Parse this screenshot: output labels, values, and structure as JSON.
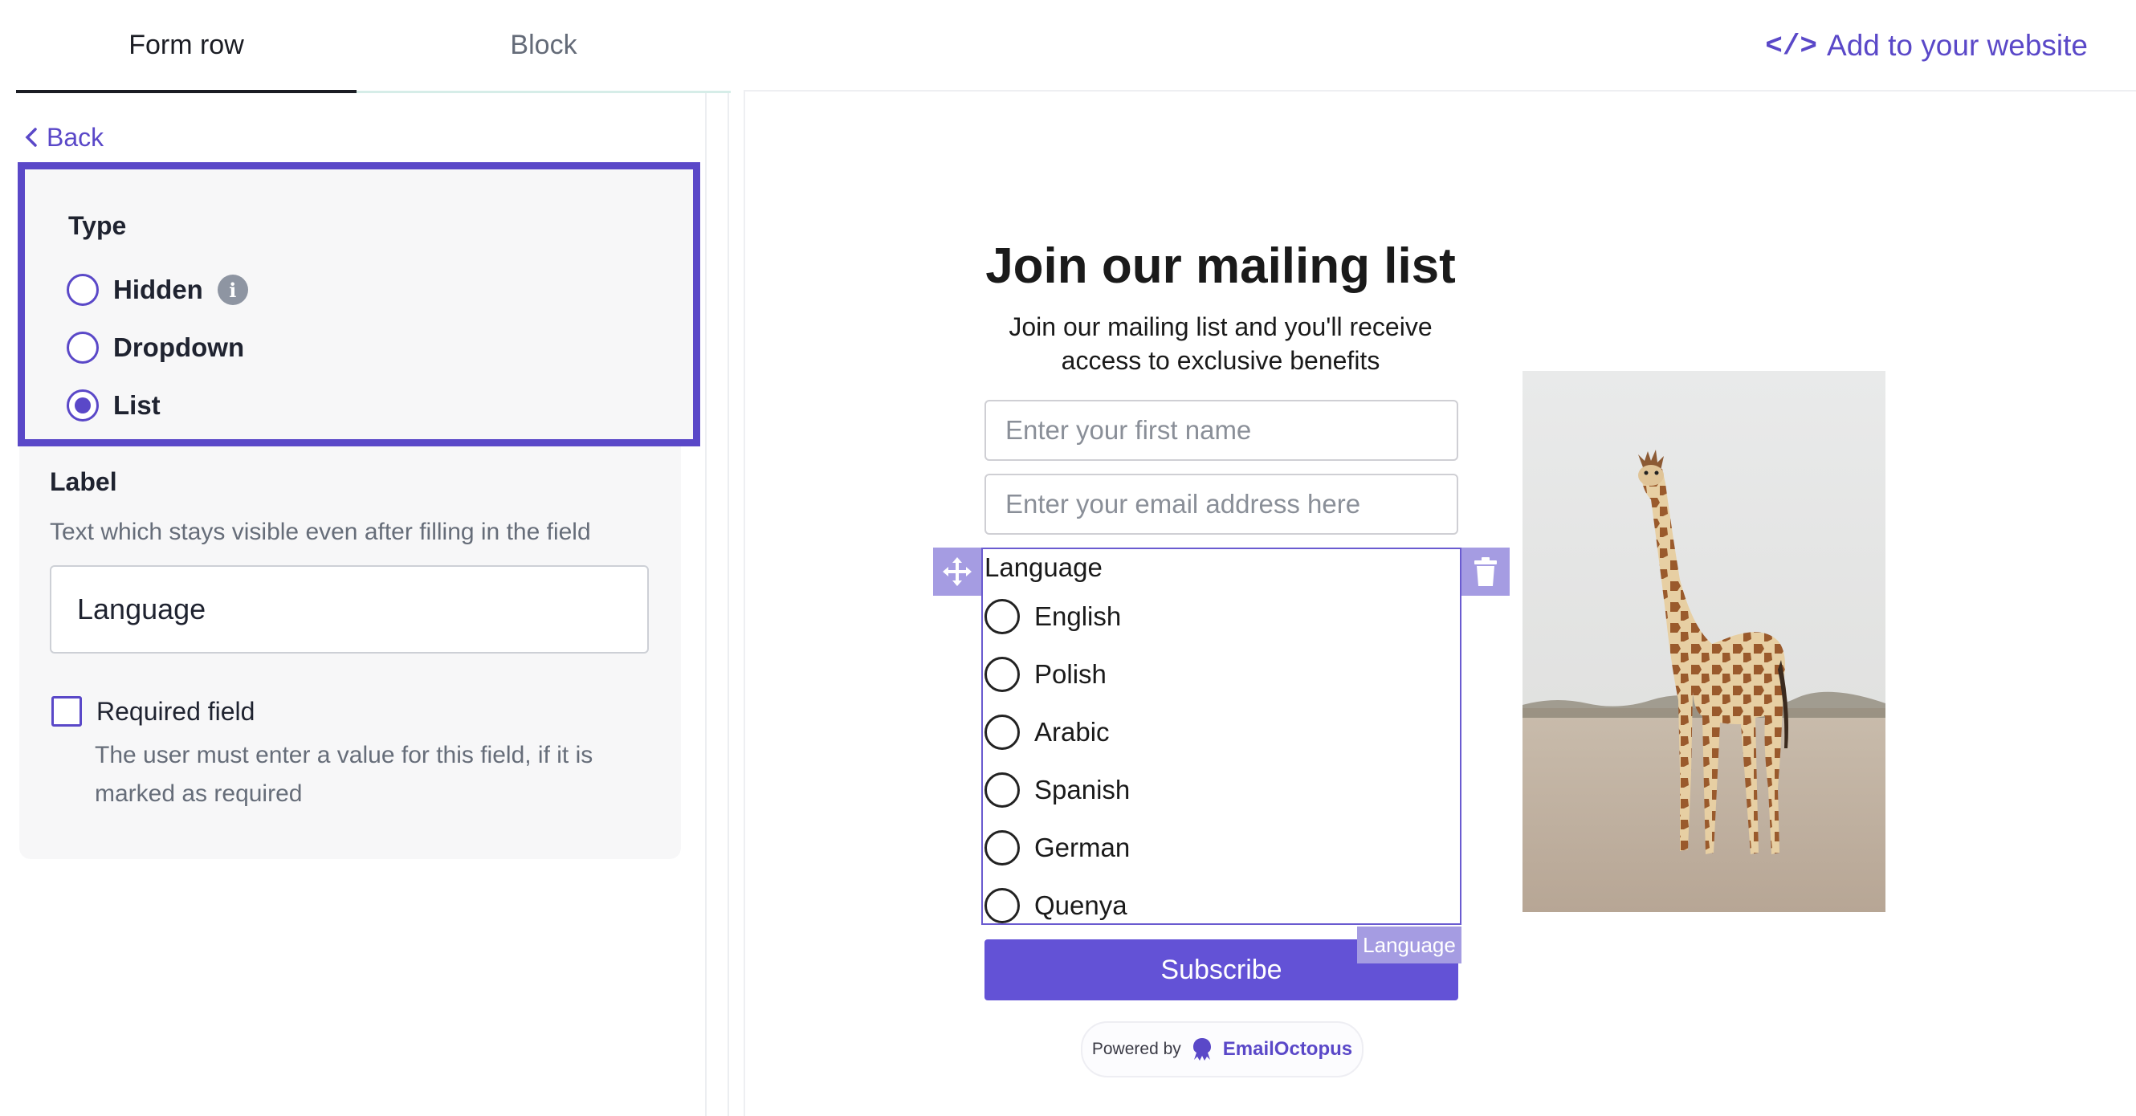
{
  "tabs": {
    "form_row": "Form row",
    "block": "Block"
  },
  "back_label": "Back",
  "type_section": {
    "title": "Type",
    "options": [
      {
        "label": "Hidden",
        "checked": false
      },
      {
        "label": "Dropdown",
        "checked": false
      },
      {
        "label": "List",
        "checked": true
      }
    ]
  },
  "label_section": {
    "title": "Label",
    "helper": "Text which stays visible even after filling in the field",
    "value": "Language"
  },
  "required": {
    "label": "Required field",
    "checked": false,
    "helper_line1": "The user must enter a value for this field, if it is",
    "helper_line2": "marked as required"
  },
  "add_to_website": {
    "code_glyph": "</>",
    "label": "Add to your website"
  },
  "form": {
    "title": "Join our mailing list",
    "subtitle_line1": "Join our mailing list and you'll receive",
    "subtitle_line2": "access to exclusive benefits",
    "first_name_placeholder": "Enter your first name",
    "email_placeholder": "Enter your email address here",
    "list_label": "Language",
    "list_options": [
      "English",
      "Polish",
      "Arabic",
      "Spanish",
      "German",
      "Quenya"
    ],
    "block_tag": "Language",
    "subscribe_label": "Subscribe",
    "powered_by": "Powered by",
    "brand": "EmailOctopus"
  },
  "colors": {
    "accent": "#5a48c8",
    "handle": "#a59ce2",
    "button": "#6352d6"
  }
}
